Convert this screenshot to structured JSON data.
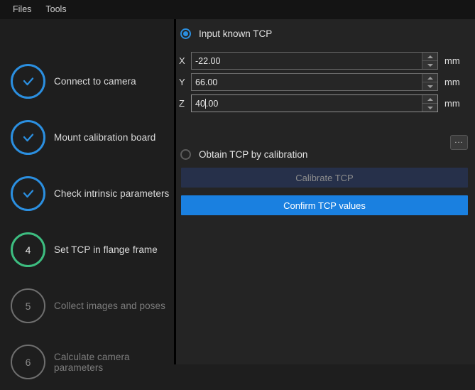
{
  "menubar": {
    "items": [
      {
        "label": "Files"
      },
      {
        "label": "Tools"
      }
    ]
  },
  "sidebar": {
    "steps": [
      {
        "number": "1",
        "label": "Connect to camera",
        "state": "done"
      },
      {
        "number": "2",
        "label": "Mount calibration board",
        "state": "done"
      },
      {
        "number": "3",
        "label": "Check intrinsic parameters",
        "state": "done"
      },
      {
        "number": "4",
        "label": "Set TCP in flange frame",
        "state": "current"
      },
      {
        "number": "5",
        "label": "Collect images and poses",
        "state": "todo"
      },
      {
        "number": "6",
        "label": "Calculate camera parameters",
        "state": "todo"
      }
    ]
  },
  "panel": {
    "input_known_tcp": {
      "label": "Input known TCP",
      "selected": "true"
    },
    "fields": [
      {
        "axis": "X",
        "value": "-22.00",
        "unit": "mm",
        "focused": "false"
      },
      {
        "axis": "Y",
        "value": "66.00",
        "unit": "mm",
        "focused": "false"
      },
      {
        "axis": "Z",
        "value_before_caret": "40",
        "value_after_caret": ".00",
        "value": "40.00",
        "unit": "mm",
        "focused": "true"
      }
    ],
    "browse_button": {
      "label": "..."
    },
    "obtain_tcp_by_calibration": {
      "label": "Obtain TCP by calibration",
      "selected": "false"
    },
    "calibrate_button": {
      "label": "Calibrate TCP",
      "enabled": "false"
    },
    "confirm_button": {
      "label": "Confirm TCP values",
      "enabled": "true"
    }
  },
  "colors": {
    "accent_blue": "#2b8fe0",
    "primary_button": "#1a80e0",
    "current_step_green": "#3dbd80",
    "disabled_button": "#26304a",
    "sidebar_bg": "#1e1e1e",
    "panel_bg": "#242424",
    "menubar_bg": "#141414"
  }
}
